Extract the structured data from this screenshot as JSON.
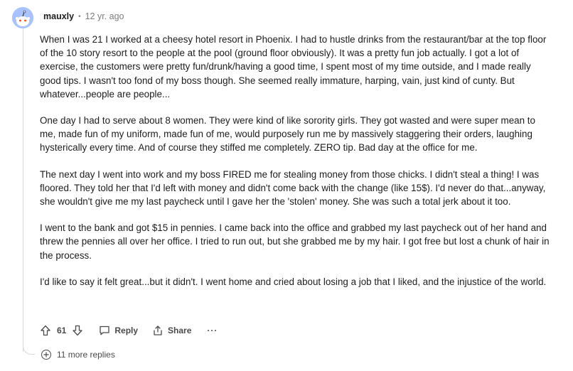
{
  "comment": {
    "username": "mauxly",
    "separator": "•",
    "timestamp": "12 yr. ago",
    "paragraphs": [
      "When I was 21 I worked at a cheesy hotel resort in Phoenix. I had to hustle drinks from the restaurant/bar at the top floor of the 10 story resort to the people at the pool (ground floor obviously). It was a pretty fun job actually. I got a lot of exercise, the customers were pretty fun/drunk/having a good time, I spent most of my time outside, and I made really good tips. I wasn't too fond of my boss though. She seemed really immature, harping, vain, just kind of cunty. But whatever...people are people...",
      "One day I had to serve about 8 women. They were kind of like sorority girls. They got wasted and were super mean to me, made fun of my uniform, made fun of me, would purposely run me by massively staggering their orders, laughing hysterically every time. And of course they stiffed me completely. ZERO tip. Bad day at the office for me.",
      "The next day I went into work and my boss FIRED me for stealing money from those chicks. I didn't steal a thing! I was floored. They told her that I'd left with money and didn't come back with the change (like 15$). I'd never do that...anyway, she wouldn't give me my last paycheck until I gave her the 'stolen' money. She was such a total jerk about it too.",
      "I went to the bank and got $15 in pennies. I came back into the office and grabbed my last paycheck out of her hand and threw the pennies all over her office. I tried to run out, but she grabbed me by my hair. I got free but lost a chunk of hair in the process.",
      "I'd like to say it felt great...but it didn't. I went home and cried about losing a job that I liked, and the injustice of the world."
    ]
  },
  "actions": {
    "score": "61",
    "reply_label": "Reply",
    "share_label": "Share",
    "more_label": "···"
  },
  "replies": {
    "label": "11 more replies"
  },
  "icons": {
    "avatar": "snoo-avatar-icon",
    "upvote": "upvote-arrow-icon",
    "downvote": "downvote-arrow-icon",
    "reply": "comment-bubble-icon",
    "share": "share-icon",
    "expand": "plus-circle-icon"
  },
  "colors": {
    "avatar_bg": "#a8c3ff",
    "text": "#1c1c1c",
    "muted": "#7c7c7c",
    "thread_line": "#d7dadc"
  }
}
